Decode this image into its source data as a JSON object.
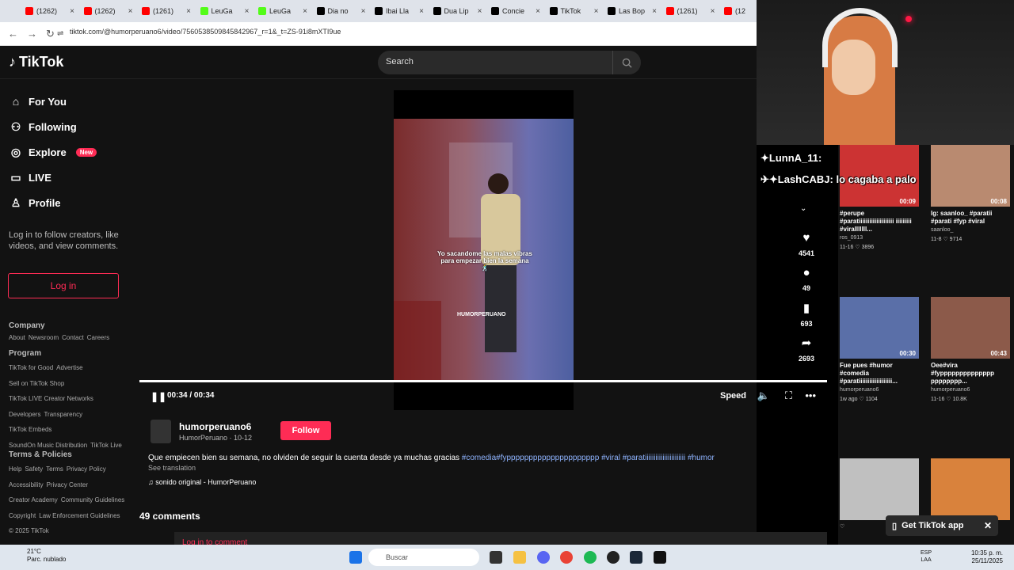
{
  "browser": {
    "tabs": [
      {
        "label": "(1262)",
        "color": "#ff0000"
      },
      {
        "label": "(1262)",
        "color": "#ff0000"
      },
      {
        "label": "(1261)",
        "color": "#ff0000"
      },
      {
        "label": "LeuGa",
        "color": "#53fc18"
      },
      {
        "label": "LeuGa",
        "color": "#53fc18"
      },
      {
        "label": "Dia no",
        "color": "#000000"
      },
      {
        "label": "Ibai Lla",
        "color": "#000000"
      },
      {
        "label": "Dua Lip",
        "color": "#000000"
      },
      {
        "label": "Concie",
        "color": "#000000"
      },
      {
        "label": "TikTok",
        "color": "#000000"
      },
      {
        "label": "Las Bop",
        "color": "#000000"
      },
      {
        "label": "(1261)",
        "color": "#ff0000"
      },
      {
        "label": "(12",
        "color": "#ff0000"
      }
    ],
    "url": "tiktok.com/@humorperuano6/video/7560538509845842967_r=1&_t=ZS-91i8mXTI9ue"
  },
  "tiktok": {
    "logo": "TikTok",
    "search_placeholder": "Search",
    "nav": [
      {
        "label": "For You",
        "icon": "home-icon"
      },
      {
        "label": "Following",
        "icon": "users-icon"
      },
      {
        "label": "Explore",
        "icon": "compass-icon",
        "badge": "New"
      },
      {
        "label": "LIVE",
        "icon": "live-icon"
      },
      {
        "label": "Profile",
        "icon": "person-icon"
      }
    ],
    "login_message": "Log in to follow creators, like videos, and view comments.",
    "login_button": "Log in",
    "company_title": "Company",
    "company_links": [
      "About",
      "Newsroom",
      "Contact",
      "Careers"
    ],
    "program_title": "Program",
    "program_links": [
      "TikTok for Good",
      "Advertise",
      "Sell on TikTok Shop",
      "TikTok LIVE Creator Networks",
      "Developers",
      "Transparency",
      "TikTok Embeds",
      "SoundOn Music Distribution",
      "TikTok Live"
    ],
    "terms_title": "Terms & Policies",
    "terms_links": [
      "Help",
      "Safety",
      "Terms",
      "Privacy Policy",
      "Accessibility",
      "Privacy Center",
      "Creator Academy",
      "Community Guidelines",
      "Copyright",
      "Law Enforcement Guidelines"
    ],
    "copyright": "© 2025 TikTok"
  },
  "video": {
    "caption": "Yo sacandome las malas vibras para empezar bien la semana 🕺",
    "watermark": "HUMORPERUANO",
    "time": "00:34 / 00:34",
    "progress": 1.0,
    "speed_label": "Speed",
    "likes": "4541",
    "comments": "49",
    "saves": "693",
    "shares": "2693"
  },
  "post": {
    "author": "humorperuano6",
    "author_sub": "HumorPeruano · 10-12",
    "follow": "Follow",
    "description": "Que empiecen bien su semana, no olviden de seguir la cuenta desde ya muchas gracias ",
    "tags": "#comedia#fyppppppppppppppppppppp #viral #parati​iiiiiiiiiiiiiiiiiiiiii #humor",
    "see_translation": "See translation",
    "sound": "♫ sonido original - HumorPeruano",
    "comments_title": "49 comments",
    "login_to_comment": "Log in to comment"
  },
  "chat": [
    {
      "user": "✦LunnA_11:",
      "text": ""
    },
    {
      "user": "✈✦LashCABJ:",
      "text": "lo cagaba a palo"
    }
  ],
  "related": [
    {
      "duration": "00:09",
      "title": "#perupe #paratiiiiiiiiiiiiiiiiiiii iiiiiiiii #viralllllll...",
      "author": "ros_0913",
      "date": "11-16",
      "likes": "3896",
      "color": "#c33"
    },
    {
      "duration": "00:08",
      "title": "Ig: saanloo_ #paratii #parati #fyp #viral",
      "author": "saanloo_",
      "date": "11-8",
      "likes": "9714",
      "color": "#b98a70"
    },
    {
      "duration": "00:30",
      "title": "Fue pues #humor #comedia #paratiiiiiiiiiiiiiiiiiii...",
      "author": "humorperuano6",
      "date": "1w ago",
      "likes": "1104",
      "color": "#5a6fa8"
    },
    {
      "duration": "00:43",
      "title": "Oee#vira #fypppppppppppppp pppppppp...",
      "author": "humorperuano6",
      "date": "11-16",
      "likes": "10.8K",
      "color": "#8c5a4a"
    },
    {
      "duration": "",
      "title": "",
      "author": "",
      "date": "",
      "likes": "",
      "color": "#c0c0c0"
    },
    {
      "duration": "",
      "title": "",
      "author": "",
      "date": "",
      "likes": "",
      "color": "#d9823c"
    }
  ],
  "get_app": "Get TikTok app",
  "taskbar": {
    "weather_temp": "21°C",
    "weather_desc": "Parc. nublado",
    "search": "Buscar",
    "lang1": "ESP",
    "lang2": "LAA",
    "time": "10:35 p. m.",
    "date": "25/11/2025"
  }
}
